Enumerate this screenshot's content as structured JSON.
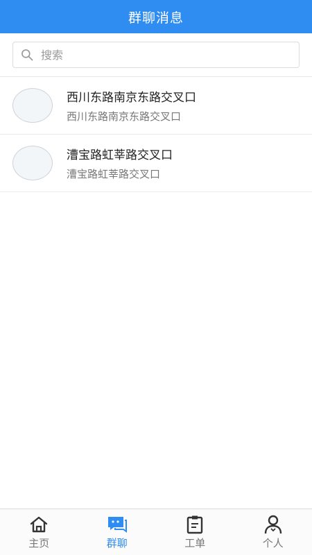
{
  "header": {
    "title": "群聊消息"
  },
  "search": {
    "placeholder": "搜索"
  },
  "chats": [
    {
      "title": "西川东路南京东路交叉口",
      "subtitle": "西川东路南京东路交叉口"
    },
    {
      "title": "漕宝路虹莘路交叉口",
      "subtitle": "漕宝路虹莘路交叉口"
    }
  ],
  "tabs": [
    {
      "label": "主页",
      "icon": "home-icon"
    },
    {
      "label": "群聊",
      "icon": "chat-icon",
      "active": true
    },
    {
      "label": "工单",
      "icon": "clipboard-icon"
    },
    {
      "label": "个人",
      "icon": "person-icon"
    }
  ],
  "colors": {
    "accent": "#2f8cf0"
  }
}
